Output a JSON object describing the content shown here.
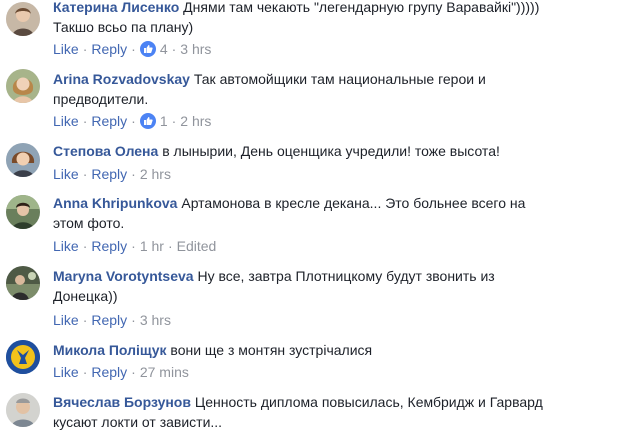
{
  "colors": {
    "author": "#365899",
    "action_link": "#4267b2",
    "meta": "#90949c",
    "text": "#1d2129",
    "like_badge": "#4c83f4"
  },
  "actions": {
    "like": "Like",
    "reply": "Reply",
    "separator": "·"
  },
  "comments": [
    {
      "author": "Катерина Лисенко",
      "text": "Днями там чекають \"легендарную групу Варавайкі\")))))",
      "text2": "Такшо всьо па плану)",
      "likes": "4",
      "time": "3 hrs",
      "avatar_icon": "profile-photo-icon"
    },
    {
      "author": "Arina Rozvadovskay",
      "text": "Так автомойщики там национальные герои и",
      "text2": "предводители.",
      "likes": "1",
      "time": "2 hrs",
      "avatar_icon": "profile-photo-icon"
    },
    {
      "author": "Степова Олена",
      "text": "в лынырии, День оценщика учредили! тоже высота!",
      "text2": "",
      "likes": "",
      "time": "2 hrs",
      "avatar_icon": "profile-photo-icon"
    },
    {
      "author": "Anna Khripunkova",
      "text": "Артамонова в кресле декана... Это больнее всего на",
      "text2": "этом фото.",
      "likes": "",
      "time": "1 hr",
      "edited": "Edited",
      "avatar_icon": "profile-photo-icon"
    },
    {
      "author": "Maryna Vorotyntseva",
      "text": "Ну все, завтра Плотницкому будут звонить из",
      "text2": "Донецка))",
      "likes": "",
      "time": "3 hrs",
      "avatar_icon": "profile-photo-icon"
    },
    {
      "author": "Микола Поліщук",
      "text": "вони ще з монтян зустрічалися",
      "text2": "",
      "likes": "",
      "time": "27 mins",
      "avatar_icon": "emblem-icon"
    },
    {
      "author": "Вячеслав Борзунов",
      "text": "Ценность диплома повысилась, Кембридж и Гарвард",
      "text2": "кусают локти от зависти...",
      "likes": "",
      "time": "",
      "avatar_icon": "profile-photo-icon"
    }
  ]
}
